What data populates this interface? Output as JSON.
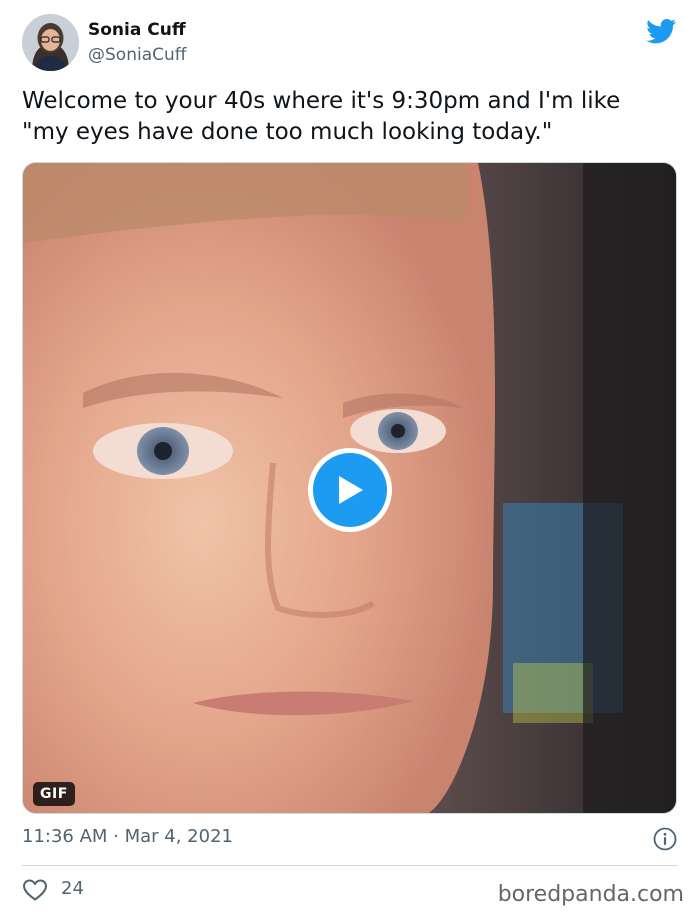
{
  "author": {
    "name": "Sonia Cuff",
    "handle": "@SoniaCuff",
    "avatar_icon": "profile-photo"
  },
  "brand": {
    "icon": "twitter-bird-icon",
    "color": "#1d9bf0"
  },
  "tweet": {
    "text_line1": "Welcome to your 40s where it's 9:30pm and I'm like",
    "text_line2": "\"my eyes have done too much looking today.\""
  },
  "media": {
    "type": "gif",
    "badge": "GIF",
    "play_icon": "play-icon",
    "description_icon": "blinking-man-gif-frame"
  },
  "meta": {
    "timestamp": "11:36 AM · Mar 4, 2021",
    "info_icon": "info-icon"
  },
  "actions": {
    "like_icon": "heart-icon",
    "like_count": "24"
  },
  "watermark": "boredpanda.com"
}
